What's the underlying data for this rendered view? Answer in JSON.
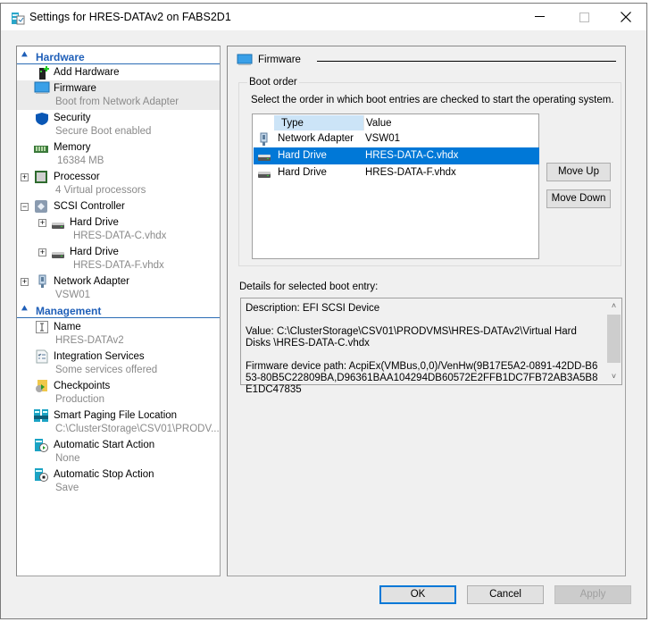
{
  "window": {
    "title": "Settings for HRES-DATAv2 on FABS2D1",
    "controls": {
      "minimize": "—",
      "maximize": "☐",
      "close": "✕"
    }
  },
  "tree": {
    "hardware_header": "Hardware",
    "management_header": "Management",
    "hardware_items": [
      {
        "label": "Add Hardware",
        "sub": "",
        "icon": "add-hardware-icon"
      },
      {
        "label": "Firmware",
        "sub": "Boot from Network Adapter",
        "icon": "firmware-monitor-icon",
        "selected": true
      },
      {
        "label": "Security",
        "sub": "Secure Boot enabled",
        "icon": "shield-icon"
      },
      {
        "label": "Memory",
        "sub": "16384 MB",
        "icon": "memory-chip-icon"
      },
      {
        "label": "Processor",
        "sub": "4 Virtual processors",
        "icon": "processor-icon",
        "expander": "+"
      },
      {
        "label": "SCSI Controller",
        "sub": "",
        "icon": "scsi-controller-icon",
        "expander": "−"
      },
      {
        "label": "Hard Drive",
        "sub": "HRES-DATA-C.vhdx",
        "icon": "hard-drive-icon",
        "expander": "+"
      },
      {
        "label": "Hard Drive",
        "sub": "HRES-DATA-F.vhdx",
        "icon": "hard-drive-icon",
        "expander": "+"
      },
      {
        "label": "Network Adapter",
        "sub": "VSW01",
        "icon": "network-adapter-icon",
        "expander": "+"
      }
    ],
    "management_items": [
      {
        "label": "Name",
        "sub": "HRES-DATAv2",
        "icon": "name-icon"
      },
      {
        "label": "Integration Services",
        "sub": "Some services offered",
        "icon": "integration-services-icon"
      },
      {
        "label": "Checkpoints",
        "sub": "Production",
        "icon": "checkpoints-icon"
      },
      {
        "label": "Smart Paging File Location",
        "sub": "C:\\ClusterStorage\\CSV01\\PRODV...",
        "icon": "smart-paging-icon"
      },
      {
        "label": "Automatic Start Action",
        "sub": "None",
        "icon": "auto-start-icon"
      },
      {
        "label": "Automatic Stop Action",
        "sub": "Save",
        "icon": "auto-stop-icon"
      }
    ]
  },
  "firmware": {
    "header": "Firmware",
    "boot_order_label": "Boot order",
    "boot_order_desc": "Select the order in which boot entries are checked to start the operating system.",
    "columns": [
      "Type",
      "Value"
    ],
    "entries": [
      {
        "type": "Network Adapter",
        "value": "VSW01",
        "icon": "network-adapter-icon"
      },
      {
        "type": "Hard Drive",
        "value": "HRES-DATA-C.vhdx",
        "icon": "hard-drive-icon",
        "selected": true
      },
      {
        "type": "Hard Drive",
        "value": "HRES-DATA-F.vhdx",
        "icon": "hard-drive-icon"
      }
    ],
    "move_up": "Move Up",
    "move_down": "Move Down",
    "details_label": "Details for selected boot entry:",
    "details": {
      "description": "Description: EFI SCSI Device",
      "value": "Value: C:\\ClusterStorage\\CSV01\\PRODVMS\\HRES-DATAv2\\Virtual Hard Disks \\HRES-DATA-C.vhdx",
      "device_path": "Firmware device path: AcpiEx(VMBus,0,0)/VenHw(9B17E5A2-0891-42DD-B653-80B5C22809BA,D96361BAA104294DB60572E2FFB1DC7FB72AB3A5B8E1DC47835"
    }
  },
  "footer": {
    "ok": "OK",
    "cancel": "Cancel",
    "apply": "Apply"
  },
  "colors": {
    "accent": "#0078d7",
    "section_header": "#1f5fb8",
    "selected_tree": "#ebebeb",
    "subtext": "#8a8a8a"
  }
}
